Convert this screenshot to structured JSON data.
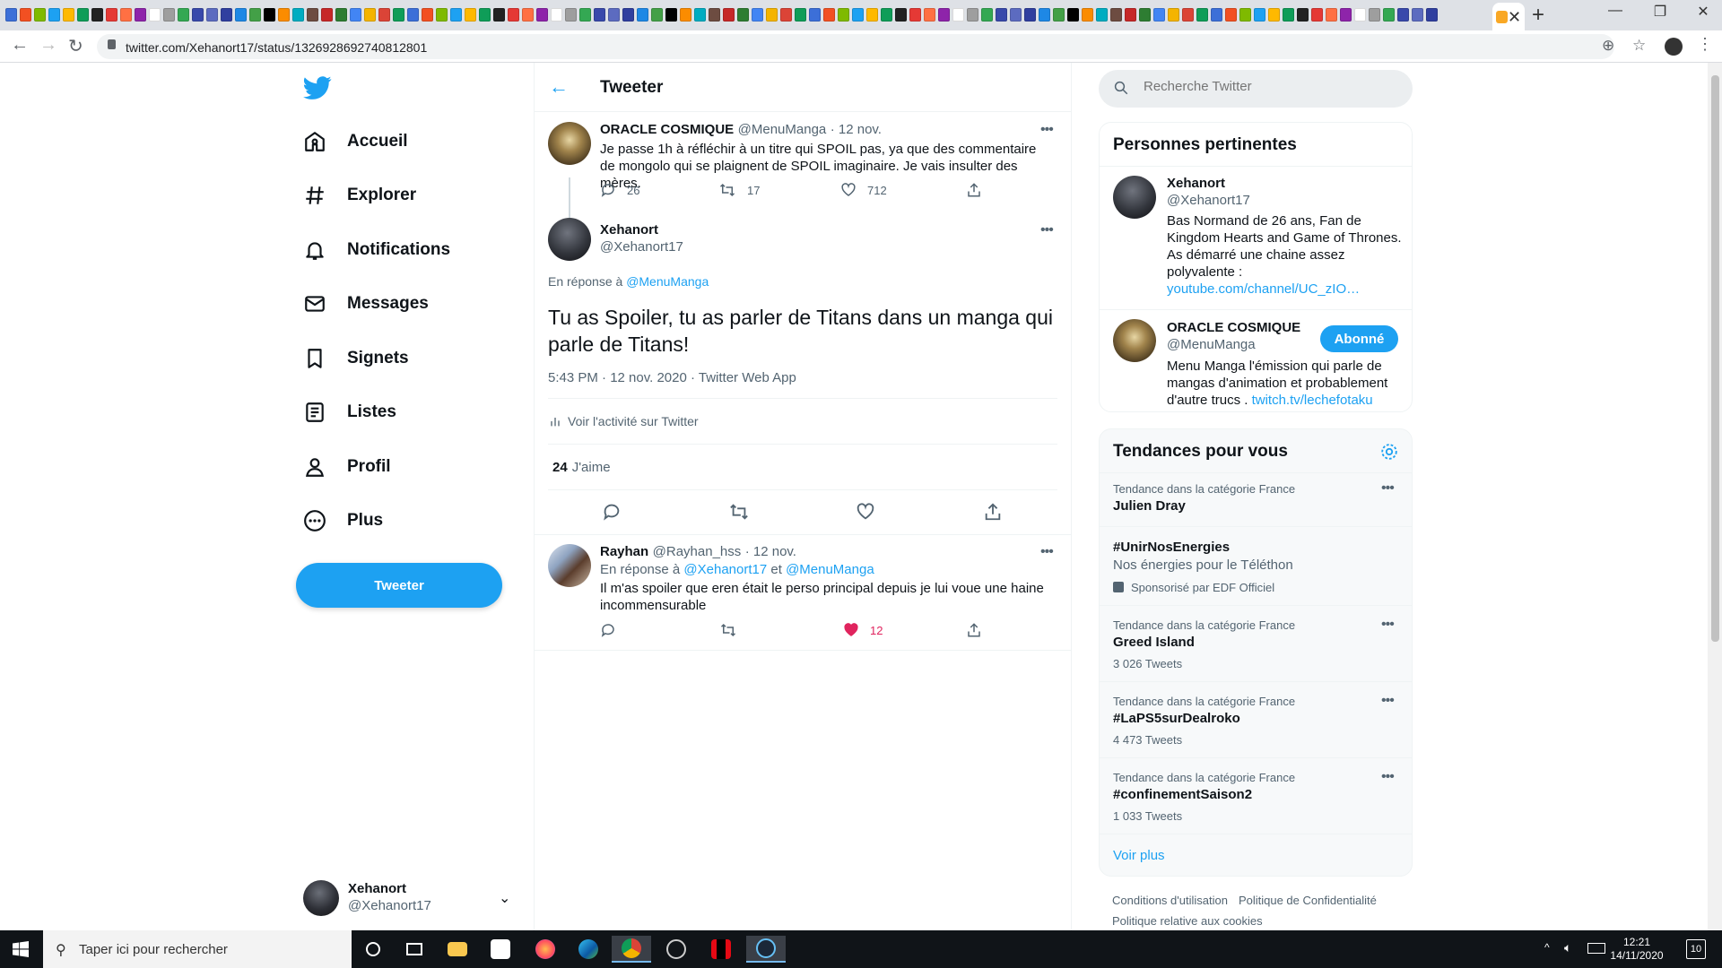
{
  "browser": {
    "url": "twitter.com/Xehanort17/status/1326928692740812801",
    "tab_close": "✕",
    "new_tab": "+",
    "favicon_colors": [
      "#3c6fd8",
      "#f25022",
      "#7fba00",
      "#1da1f2",
      "#ffb900",
      "#0f9d58",
      "#222222",
      "#e53935",
      "#ff7043",
      "#8e24aa",
      "#ffffff",
      "#9e9e9e",
      "#34a853",
      "#3949ab",
      "#5c6bc0",
      "#303f9f",
      "#1e88e5",
      "#43a047",
      "#000000",
      "#fb8c00",
      "#00acc1",
      "#6d4c41",
      "#c62828",
      "#2e7d32",
      "#4285f4",
      "#f4b400",
      "#db4437",
      "#0f9d58"
    ]
  },
  "nav": {
    "items": [
      {
        "label": "Accueil",
        "icon": "home-icon"
      },
      {
        "label": "Explorer",
        "icon": "hashtag-icon"
      },
      {
        "label": "Notifications",
        "icon": "bell-icon"
      },
      {
        "label": "Messages",
        "icon": "envelope-icon"
      },
      {
        "label": "Signets",
        "icon": "bookmark-icon"
      },
      {
        "label": "Listes",
        "icon": "list-icon"
      },
      {
        "label": "Profil",
        "icon": "person-icon"
      },
      {
        "label": "Plus",
        "icon": "more-circle-icon"
      }
    ],
    "tweet_button": "Tweeter",
    "account": {
      "name": "Xehanort",
      "handle": "@Xehanort17"
    }
  },
  "main": {
    "title": "Tweeter",
    "parent_tweet": {
      "name": "ORACLE COSMIQUE",
      "handle": "@MenuManga",
      "date": "· 12 nov.",
      "text": "Je passe 1h à réfléchir à un titre qui SPOIL pas, ya que des commentaire de mongolo qui se plaignent de SPOIL imaginaire. Je vais insulter des mères.",
      "replies": "26",
      "retweets": "17",
      "likes": "712"
    },
    "focal_tweet": {
      "name": "Xehanort",
      "handle": "@Xehanort17",
      "reply_prefix": "En réponse à",
      "reply_to": "@MenuManga",
      "text": "Tu as Spoiler, tu as parler de Titans dans un manga qui parle de Titans!",
      "timestamp": "5:43 PM · 12 nov. 2020 · Twitter Web App",
      "activity": "Voir l'activité sur Twitter",
      "like_count": "24",
      "like_label": "J'aime"
    },
    "reply_tweet": {
      "name": "Rayhan",
      "handle": "@Rayhan_hss",
      "date": "· 12 nov.",
      "reply_prefix": "En réponse à",
      "reply_to_1": "@Xehanort17",
      "reply_and": "et",
      "reply_to_2": "@MenuManga",
      "text": "Il m'as spoiler que eren était le perso principal depuis je lui voue une haine incommensurable",
      "likes": "12"
    }
  },
  "right": {
    "search_placeholder": "Recherche Twitter",
    "people_title": "Personnes pertinentes",
    "people": [
      {
        "name": "Xehanort",
        "handle": "@Xehanort17",
        "bio": "Bas Normand de 26 ans, Fan de Kingdom Hearts and Game of Thrones. As démarré une chaine assez polyvalente :",
        "link": "youtube.com/channel/UC_zIO…"
      },
      {
        "name": "ORACLE COSMIQUE",
        "handle": "@MenuManga",
        "bio": "Menu Manga l'émission qui parle de mangas d'animation et probablement d'autre trucs .",
        "link": "twitch.tv/lechefotaku",
        "button": "Abonné"
      }
    ],
    "trends_title": "Tendances pour vous",
    "trends": [
      {
        "context": "Tendance dans la catégorie France",
        "name": "Julien Dray",
        "count": ""
      },
      {
        "context": "",
        "name": "#UnirNosEnergies",
        "subtitle": "Nos énergies pour le Téléthon",
        "count": "Sponsorisé par EDF Officiel"
      },
      {
        "context": "Tendance dans la catégorie France",
        "name": "Greed Island",
        "count": "3 026 Tweets"
      },
      {
        "context": "Tendance dans la catégorie France",
        "name": "#LaPS5surDealroko",
        "count": "4 473 Tweets"
      },
      {
        "context": "Tendance dans la catégorie France",
        "name": "#confinementSaison2",
        "count": "1 033 Tweets"
      }
    ],
    "show_more": "Voir plus",
    "footer": [
      "Conditions d'utilisation",
      "Politique de Confidentialité",
      "Politique relative aux cookies"
    ]
  },
  "taskbar": {
    "search_text": "Taper ici pour rechercher",
    "time": "12:21",
    "date": "14/11/2020",
    "notification_count": "10"
  },
  "colors": {
    "accent": "#1da1f2",
    "like": "#e0245e"
  }
}
